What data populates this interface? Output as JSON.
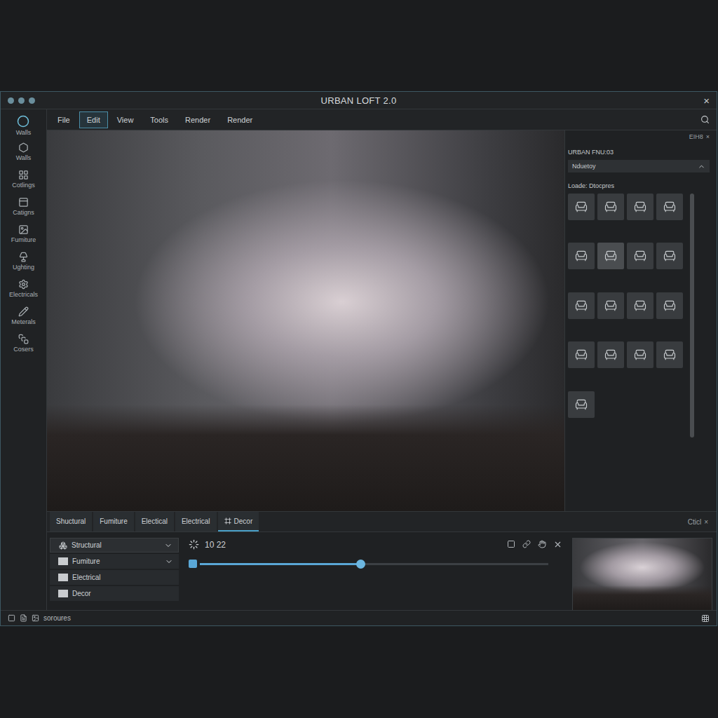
{
  "window": {
    "title": "URBAN LOFT 2.0",
    "close": "×"
  },
  "menu": [
    {
      "label": "File",
      "selected": false
    },
    {
      "label": "Edit",
      "selected": true
    },
    {
      "label": "View",
      "selected": false
    },
    {
      "label": "Tools",
      "selected": false
    },
    {
      "label": "Render",
      "selected": false
    },
    {
      "label": "Render",
      "selected": false
    }
  ],
  "sidebar": {
    "items": [
      {
        "label": "Walls",
        "selected": true
      },
      {
        "label": "Walls",
        "selected": false
      },
      {
        "label": "Cotlings",
        "selected": false
      },
      {
        "label": "Catigns",
        "selected": false
      },
      {
        "label": "Fumiture",
        "selected": false
      },
      {
        "label": "Ughting",
        "selected": false
      },
      {
        "label": "Electricals",
        "selected": false
      },
      {
        "label": "Meterals",
        "selected": false
      },
      {
        "label": "Cosers",
        "selected": false
      }
    ]
  },
  "library": {
    "header": "ΕΙΗ8",
    "close": "×",
    "title": "URBAN FNU:03",
    "dropdown": "Nduetoy",
    "section": "Loade: Dtocpres",
    "items": [
      {
        "selected": false
      },
      {
        "selected": false
      },
      {
        "selected": false
      },
      {
        "selected": false
      },
      {
        "selected": false
      },
      {
        "selected": true
      },
      {
        "selected": false
      },
      {
        "selected": false
      },
      {
        "selected": false
      },
      {
        "selected": false
      },
      {
        "selected": false
      },
      {
        "selected": false
      },
      {
        "selected": false
      },
      {
        "selected": false
      },
      {
        "selected": false
      },
      {
        "selected": false
      },
      {
        "selected": false
      }
    ]
  },
  "bottom_tabs": [
    {
      "label": "Shuctural",
      "selected": false
    },
    {
      "label": "Fumiture",
      "selected": false
    },
    {
      "label": "Electical",
      "selected": false
    },
    {
      "label": "Electrical",
      "selected": false
    },
    {
      "label": "Decor",
      "selected": true
    }
  ],
  "bottom_panel": {
    "title": "Cticl",
    "close": "×"
  },
  "layers": [
    {
      "label": "Structural",
      "kind": "group"
    },
    {
      "label": "Fumiture",
      "kind": "folder"
    },
    {
      "label": "Electrical",
      "kind": "item"
    },
    {
      "label": "Decor",
      "kind": "item"
    }
  ],
  "timeline": {
    "reading": "10 22",
    "level": 0.46
  },
  "status_bar": {
    "text": "soroures"
  }
}
